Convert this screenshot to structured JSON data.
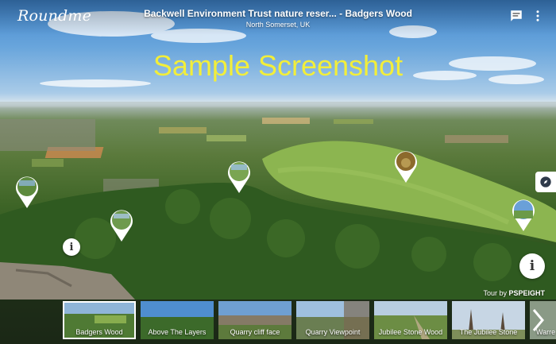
{
  "app": {
    "logo": "Roundme"
  },
  "header": {
    "title": "Backwell Environment Trust nature reser... - Badgers Wood",
    "subtitle": "North Somerset, UK"
  },
  "watermark": "Sample Screenshot",
  "icons": {
    "comment": "comment-icon",
    "menu": "more-vert-icon",
    "compass": "compass-icon",
    "info": "info-icon",
    "next": "chevron-right-icon"
  },
  "info_label": "i",
  "tour_by": {
    "prefix": "Tour by",
    "author": "PSPEIGHT"
  },
  "hotspots": [
    "hotspot-1",
    "hotspot-2",
    "hotspot-3",
    "hotspot-4",
    "hotspot-5"
  ],
  "thumbnails": [
    {
      "label": "Badgers Wood",
      "active": true
    },
    {
      "label": "Above The Layers",
      "active": false
    },
    {
      "label": "Quarry cliff face",
      "active": false
    },
    {
      "label": "Quarry Viewpoint",
      "active": false
    },
    {
      "label": "Jubilee Stone Wood",
      "active": false
    },
    {
      "label": "The Jubilee Stone",
      "active": false
    },
    {
      "label": "Warre",
      "active": false
    }
  ]
}
